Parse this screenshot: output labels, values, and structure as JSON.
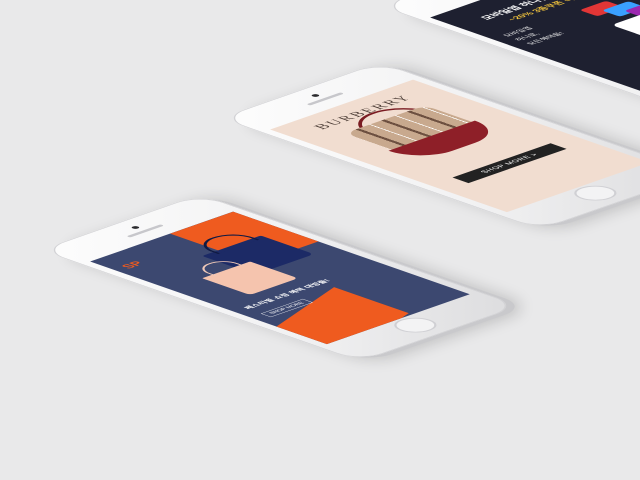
{
  "scene": {
    "description_visible_text": "",
    "left_phone": {
      "brand": "SP",
      "headline": "페스티벌 쇼핑 혜택 대방출!",
      "button": "SHOP MORE",
      "colors": {
        "navy": "#3c4870",
        "orange": "#ef5b1f"
      }
    },
    "middle_phone": {
      "brand_logo": "BURBERRY",
      "button": "SHOP MORE  >",
      "colors": {
        "background": "#f1ddd0",
        "accent": "#8e1f28"
      }
    },
    "right_phone": {
      "line1": "모바일앱 하나만 있어도",
      "line2": "~20% 3종쿠폰 득템",
      "line3": "모바일앱",
      "line4": "하나로,",
      "line5": "모든혜택을!",
      "colors": {
        "background": "#1e2030",
        "highlight": "#f0c23c"
      }
    }
  }
}
